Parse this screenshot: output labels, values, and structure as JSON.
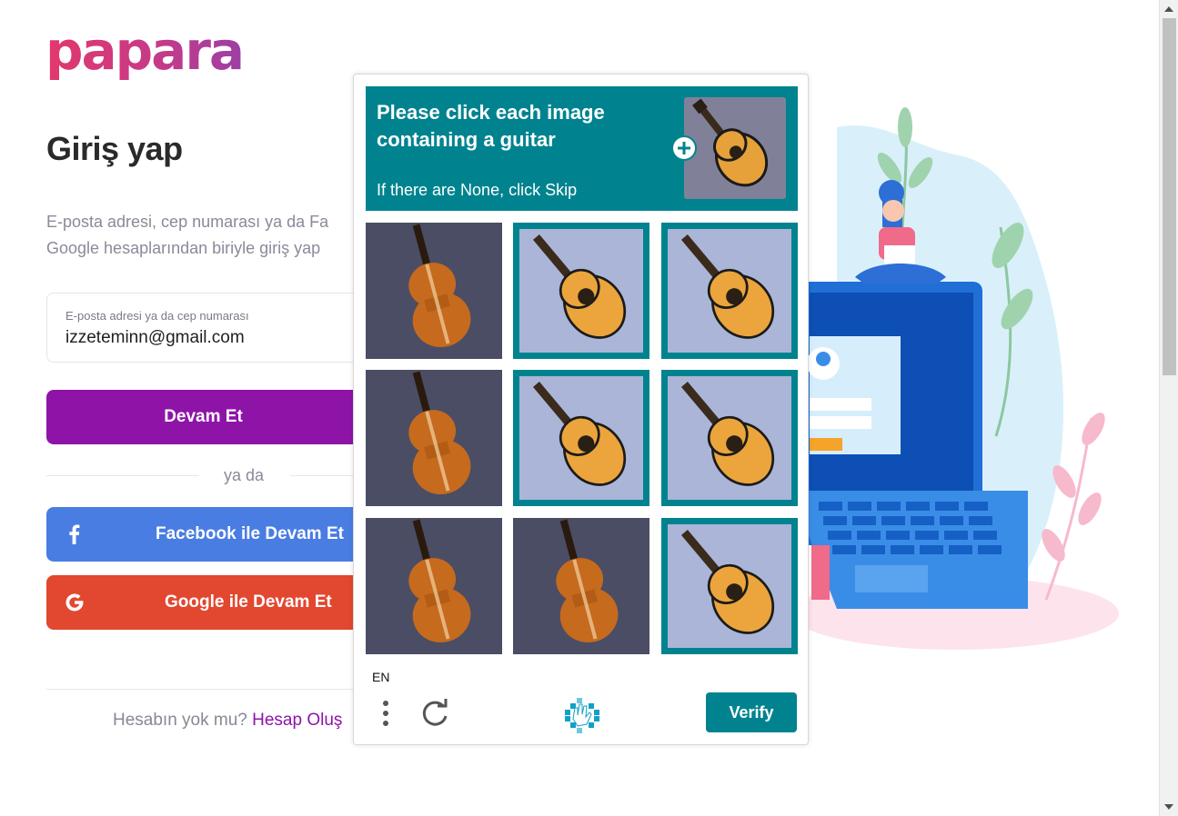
{
  "brand": {
    "logo_text": "papara"
  },
  "login": {
    "title": "Giriş yap",
    "description": "E-posta adresi, cep numarası ya da Fa\nGoogle hesaplarından biriyle giriş yap",
    "email_label": "E-posta adresi ya da cep numarası",
    "email_value": "izzeteminn@gmail.com",
    "continue_label": "Devam Et",
    "or_label": "ya da",
    "facebook_label": "Facebook ile Devam Et",
    "google_label": "Google ile Devam Et",
    "footer_question": "Hesabın yok mu?",
    "footer_link": "Hesap Oluş"
  },
  "captcha": {
    "prompt": "Please click each image containing a guitar",
    "sub": "If there are None, click Skip",
    "language": "EN",
    "verify_label": "Verify",
    "tiles": [
      {
        "subject": "violin",
        "selected": false
      },
      {
        "subject": "guitar",
        "selected": true
      },
      {
        "subject": "guitar",
        "selected": true
      },
      {
        "subject": "violin",
        "selected": false
      },
      {
        "subject": "guitar",
        "selected": true
      },
      {
        "subject": "guitar",
        "selected": true
      },
      {
        "subject": "violin",
        "selected": false
      },
      {
        "subject": "violin",
        "selected": false
      },
      {
        "subject": "guitar",
        "selected": true
      }
    ]
  },
  "colors": {
    "brand_purple": "#8e14a8",
    "facebook_blue": "#4a7de2",
    "google_red": "#e2472f",
    "captcha_teal": "#00838f"
  }
}
